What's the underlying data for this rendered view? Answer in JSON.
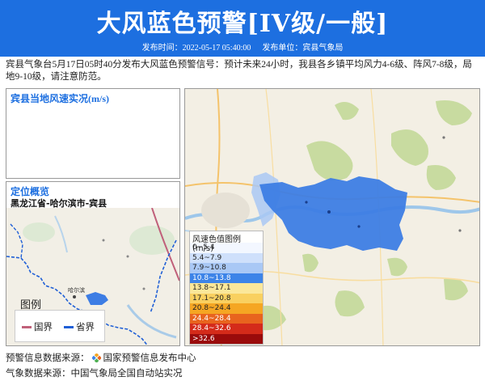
{
  "banner": {
    "title": "大风蓝色预警[IV级/一般]"
  },
  "subbar": {
    "publish_time": "发布时间：2022-05-17 05:40:00",
    "publish_unit": "发布单位：宾县气象局"
  },
  "description": "宾县气象台5月17日05时40分发布大风蓝色预警信号：预计未来24小时，我县各乡镇平均风力4-6级、阵风7-8级，局地9-10级，请注意防范。",
  "wind_panel": {
    "title": "宾县当地风速实况(m/s)"
  },
  "location_panel": {
    "title": "定位概览",
    "subtitle": "黑龙江省-哈尔滨市-宾县",
    "city_labels": [
      "哈尔滨",
      "长春"
    ],
    "legend": {
      "title": "图例",
      "national": "国界",
      "provincial": "省界"
    }
  },
  "wind_legend": {
    "title": "风速色值图例 (m/s)",
    "ranges": [
      {
        "label": "0~5.4",
        "color": "#f3f7ff"
      },
      {
        "label": "5.4~7.9",
        "color": "#cfe0fb"
      },
      {
        "label": "7.9~10.8",
        "color": "#a9c8f5"
      },
      {
        "label": "10.8~13.8",
        "color": "#3d84e8"
      },
      {
        "label": "13.8~17.1",
        "color": "#fbe79a"
      },
      {
        "label": "17.1~20.8",
        "color": "#f9d060"
      },
      {
        "label": "20.8~24.4",
        "color": "#f5a623"
      },
      {
        "label": "24.4~28.4",
        "color": "#e8641e"
      },
      {
        "label": "28.4~32.6",
        "color": "#d42b1a"
      },
      {
        "label": ">32.6",
        "color": "#9a0b0b"
      }
    ]
  },
  "colors": {
    "banner": "#1d6fe0",
    "warning_area": "#3d7de4",
    "national_border": "#c0607a",
    "provincial_border": "#1f5fd6"
  },
  "footer": {
    "warning_source_label": "预警信息数据来源：",
    "warning_source_name": "国家预警信息发布中心",
    "weather_source": "气象数据来源：中国气象局全国自动站实况"
  }
}
